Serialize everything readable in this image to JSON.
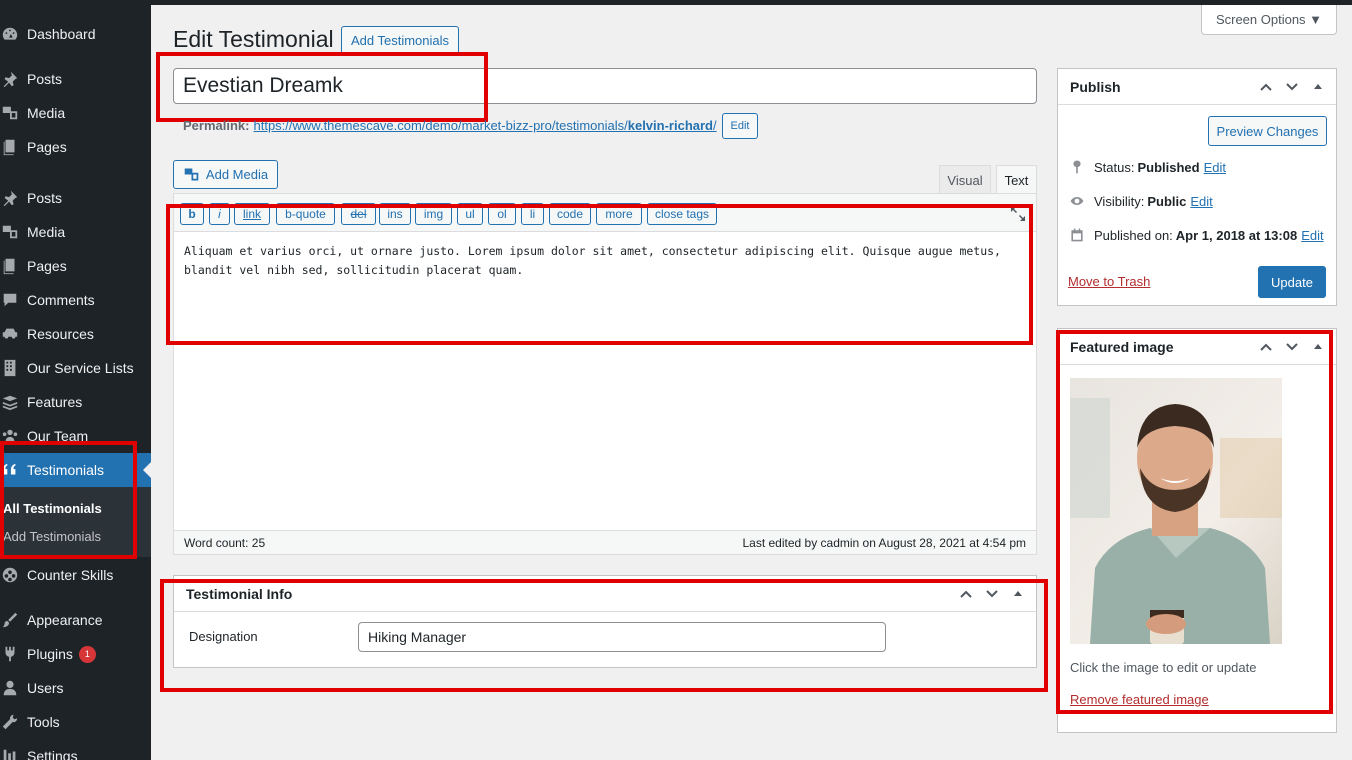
{
  "sidebar": {
    "items": [
      {
        "label": "Dashboard",
        "icon": "dashboard-icon"
      },
      {
        "label": "Posts",
        "icon": "pin-icon"
      },
      {
        "label": "Media",
        "icon": "media-icon"
      },
      {
        "label": "Pages",
        "icon": "pages-icon"
      },
      {
        "label": "Posts",
        "icon": "pin-icon"
      },
      {
        "label": "Media",
        "icon": "media-icon"
      },
      {
        "label": "Pages",
        "icon": "pages-icon"
      },
      {
        "label": "Comments",
        "icon": "comment-icon"
      },
      {
        "label": "Resources",
        "icon": "car-icon"
      },
      {
        "label": "Our Service Lists",
        "icon": "building-icon"
      },
      {
        "label": "Features",
        "icon": "layers-icon"
      },
      {
        "label": "Our Team",
        "icon": "group-icon"
      },
      {
        "label": "Testimonials",
        "icon": "quote-icon"
      },
      {
        "label": "Counter Skills",
        "icon": "wheel-icon"
      },
      {
        "label": "Appearance",
        "icon": "brush-icon"
      },
      {
        "label": "Plugins",
        "icon": "plugin-icon",
        "badge": "1"
      },
      {
        "label": "Users",
        "icon": "user-icon"
      },
      {
        "label": "Tools",
        "icon": "wrench-icon"
      },
      {
        "label": "Settings",
        "icon": "settings-icon"
      }
    ],
    "submenu": [
      "All Testimonials",
      "Add Testimonials"
    ]
  },
  "header": {
    "title": "Edit Testimonial",
    "add_button": "Add Testimonials",
    "screen_options": "Screen Options ▼"
  },
  "post": {
    "title": "Evestian Dreamk",
    "permalink_label": "Permalink:",
    "permalink_url": "https://www.themescave.com/demo/market-bizz-pro/testimonials/",
    "permalink_slug": "kelvin-richard",
    "permalink_tail": "/",
    "permalink_edit": "Edit"
  },
  "editor": {
    "add_media": "Add Media",
    "tab_visual": "Visual",
    "tab_text": "Text",
    "quicktags": [
      "b",
      "i",
      "link",
      "b-quote",
      "del",
      "ins",
      "img",
      "ul",
      "ol",
      "li",
      "code",
      "more",
      "close tags"
    ],
    "content": "Aliquam et varius orci, ut ornare justo. Lorem ipsum dolor sit amet, consectetur adipiscing elit. Quisque augue metus, blandit vel nibh sed, sollicitudin placerat quam.",
    "word_count": "Word count: 25",
    "last_edited": "Last edited by cadmin on August 28, 2021 at 4:54 pm"
  },
  "testimonial_info": {
    "title": "Testimonial Info",
    "designation_label": "Designation",
    "designation_value": "Hiking Manager"
  },
  "publish": {
    "title": "Publish",
    "preview": "Preview Changes",
    "status_label": "Status:",
    "status_value": "Published",
    "visibility_label": "Visibility:",
    "visibility_value": "Public",
    "published_label": "Published on:",
    "published_value": "Apr 1, 2018 at 13:08",
    "edit": "Edit",
    "trash": "Move to Trash",
    "update": "Update"
  },
  "featured_image": {
    "title": "Featured image",
    "hint": "Click the image to edit or update",
    "remove": "Remove featured image"
  },
  "colors": {
    "accent": "#2271b1",
    "sidebar": "#1d2327",
    "highlight": "#e00000"
  }
}
